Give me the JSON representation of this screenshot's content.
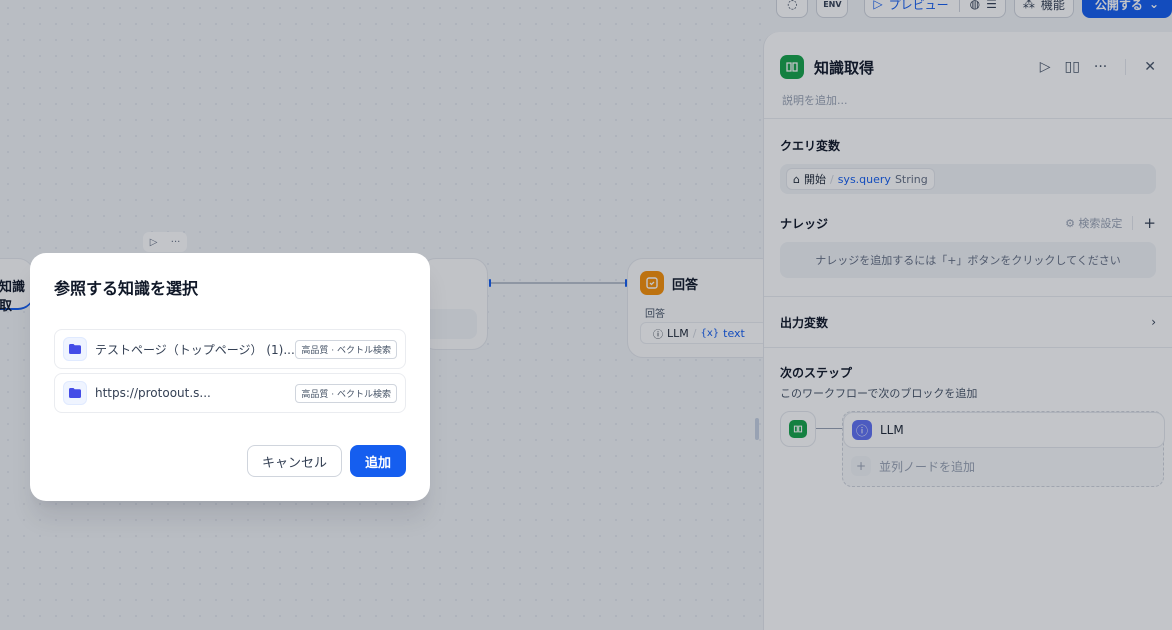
{
  "toolbar": {
    "preview_label": "プレビュー",
    "features_label": "機能",
    "publish_label": "公開する"
  },
  "canvas": {
    "left_node_label": "知識取",
    "answer_node": {
      "title": "回答",
      "field_label": "回答",
      "var_source": "LLM",
      "var_name": "text"
    }
  },
  "panel": {
    "title": "知識取得",
    "description_placeholder": "説明を追加...",
    "query": {
      "title": "クエリ変数",
      "source": "開始",
      "var": "sys.query",
      "type": "String"
    },
    "knowledge": {
      "title": "ナレッジ",
      "search_settings": "検索設定",
      "empty_hint": "ナレッジを追加するには「+」ボタンをクリックしてください"
    },
    "output": {
      "title": "出力変数"
    },
    "next": {
      "title": "次のステップ",
      "subtitle": "このワークフローで次のブロックを追加",
      "llm_label": "LLM",
      "add_parallel": "並列ノードを追加"
    }
  },
  "modal": {
    "title": "参照する知識を選択",
    "items": [
      {
        "name": "テストページ（トップページ） (1)...",
        "badge": "高品質 · ベクトル検索"
      },
      {
        "name": "https://protoout.s...",
        "badge": "高品質 · ベクトル検索"
      }
    ],
    "cancel_label": "キャンセル",
    "add_label": "追加"
  },
  "colors": {
    "accent": "#155eef",
    "knowledge_node": "#16a34a",
    "answer_node": "#f79009",
    "llm_node": "#6172f3"
  }
}
